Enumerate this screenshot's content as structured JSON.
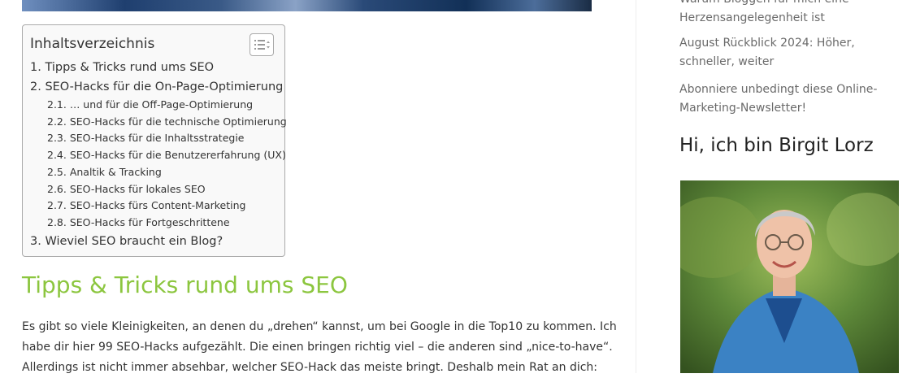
{
  "toc": {
    "title": "Inhaltsverzeichnis",
    "items": [
      {
        "label": "1. Tipps & Tricks rund ums SEO"
      },
      {
        "label": "2. SEO-Hacks für die On-Page-Optimierung"
      },
      {
        "label": "2.1. … und für die Off-Page-Optimierung"
      },
      {
        "label": "2.2. SEO-Hacks für die technische Optimierung"
      },
      {
        "label": "2.3. SEO-Hacks für die Inhaltsstrategie"
      },
      {
        "label": "2.4. SEO-Hacks für die Benutzererfahrung (UX)"
      },
      {
        "label": "2.5. Analtik & Tracking"
      },
      {
        "label": "2.6. SEO-Hacks für lokales SEO"
      },
      {
        "label": "2.7. SEO-Hacks fürs Content-Marketing"
      },
      {
        "label": "2.8. SEO-Hacks für Fortgeschrittene"
      },
      {
        "label": "3. Wieviel SEO braucht ein Blog?"
      }
    ]
  },
  "article": {
    "heading": "Tipps & Tricks rund ums SEO",
    "lines": [
      "Es gibt so viele Kleinigkeiten, an denen du „drehen“ kannst, um bei Google in die Top10 zu kommen. Ich",
      "habe dir hier 99 SEO-Hacks aufgezählt. Die einen bringen richtig viel – die anderen sind „nice-to-have“.",
      "Allerdings ist nicht immer absehbar, welcher SEO-Hack das meiste bringt. Deshalb mein Rat an dich:"
    ]
  },
  "sidebar": {
    "recent_posts": [
      {
        "lines": [
          "Warum Bloggen für mich eine",
          "Herzensangelegenheit ist"
        ]
      },
      {
        "lines": [
          "August Rückblick 2024: Höher,",
          "schneller, weiter"
        ]
      },
      {
        "lines": [
          "Abonniere unbedingt diese Online-",
          "Marketing-Newsletter!"
        ]
      }
    ],
    "about_title": "Hi, ich bin Birgit Lorz"
  },
  "colors": {
    "heading_green": "#8cc63f",
    "link_gray": "#6a6a6a",
    "toc_bg": "#f9f9f9"
  }
}
